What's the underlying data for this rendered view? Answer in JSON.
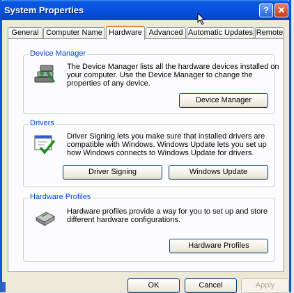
{
  "window": {
    "title": "System Properties"
  },
  "titlebar": {
    "help_glyph": "?",
    "close_glyph": "✕"
  },
  "tabs": [
    {
      "label": "General"
    },
    {
      "label": "Computer Name"
    },
    {
      "label": "Hardware",
      "active": true
    },
    {
      "label": "Advanced"
    },
    {
      "label": "Automatic Updates"
    },
    {
      "label": "Remote"
    }
  ],
  "device_manager": {
    "title": "Device Manager",
    "description": "The Device Manager lists all the hardware devices installed on your computer. Use the Device Manager to change the properties of any device.",
    "button": "Device Manager",
    "icon": "device-manager-icon"
  },
  "drivers": {
    "title": "Drivers",
    "description": "Driver Signing lets you make sure that installed drivers are compatible with Windows. Windows Update lets you set up how Windows connects to Windows Update for drivers.",
    "button_signing": "Driver Signing",
    "button_update": "Windows Update",
    "icon": "driver-signing-icon"
  },
  "hardware_profiles": {
    "title": "Hardware Profiles",
    "description": "Hardware profiles provide a way for you to set up and store different hardware configurations.",
    "button": "Hardware Profiles",
    "icon": "hardware-profiles-icon"
  },
  "footer": {
    "ok": "OK",
    "cancel": "Cancel",
    "apply": "Apply"
  },
  "colors": {
    "titlebar": "#0a58e0",
    "group_title": "#0046d5",
    "active_tab_accent": "#e68b2c"
  }
}
